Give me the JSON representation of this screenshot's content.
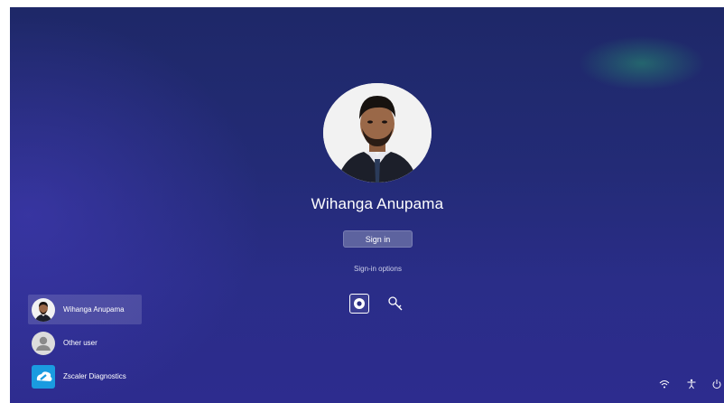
{
  "lock_screen": {
    "username": "Wihanga Anupama",
    "sign_in_label": "Sign in",
    "sign_in_options_label": "Sign-in options",
    "sign_in_methods": [
      {
        "icon": "pin-icon",
        "selected": true
      },
      {
        "icon": "key-icon",
        "selected": false
      }
    ]
  },
  "users": [
    {
      "label": "Wihanga Anupama",
      "icon": "user-photo-icon",
      "selected": true
    },
    {
      "label": "Other user",
      "icon": "generic-user-icon",
      "selected": false
    },
    {
      "label": "Zscaler Diagnostics",
      "icon": "zscaler-logo-icon",
      "selected": false
    }
  ],
  "tray": [
    {
      "icon": "wifi-icon"
    },
    {
      "icon": "accessibility-icon"
    },
    {
      "icon": "power-icon"
    }
  ],
  "colors": {
    "background_top": "#1e2868",
    "background_bottom": "#2d2c8e",
    "button": "#5d639f",
    "zscaler_blue": "#1a9be0"
  }
}
